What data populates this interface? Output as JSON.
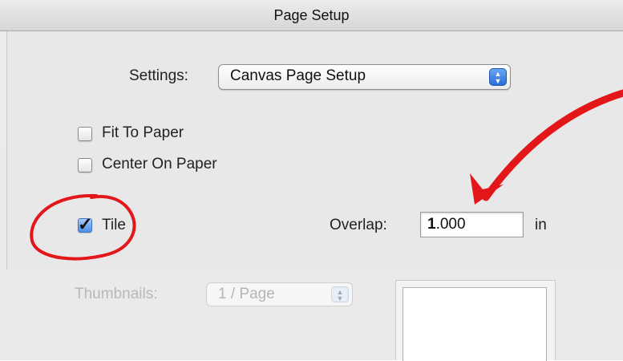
{
  "window": {
    "title": "Page Setup"
  },
  "settings": {
    "label": "Settings:",
    "value": "Canvas Page Setup"
  },
  "options": {
    "fit_to_paper": {
      "label": "Fit To Paper",
      "checked": false
    },
    "center_on_paper": {
      "label": "Center On Paper",
      "checked": false
    },
    "tile": {
      "label": "Tile",
      "checked": true
    }
  },
  "overlap": {
    "label": "Overlap:",
    "value_first": "1",
    "value_rest": ".000",
    "unit": "in"
  },
  "thumbnails": {
    "label": "Thumbnails:",
    "value": "1 / Page",
    "enabled": false
  },
  "colors": {
    "annotation_red": "#e3161a",
    "checkbox_checked": "#4f8ee6",
    "disabled_text": "#b9b9b9"
  },
  "icons": {
    "popup_stepper": "up-down-arrows-icon",
    "checkmark": "checkmark-icon"
  }
}
